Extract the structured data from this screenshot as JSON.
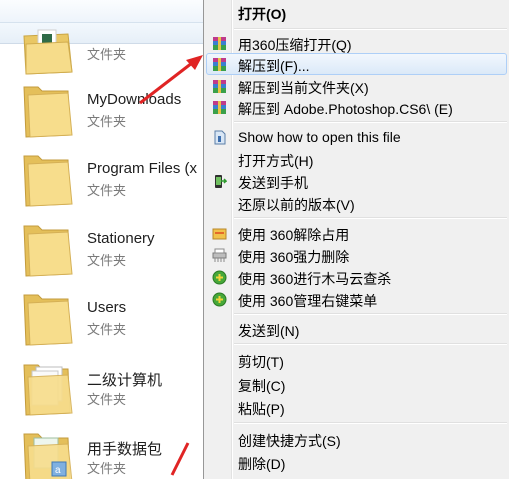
{
  "explorer": {
    "folders": [
      {
        "name": "",
        "type": "文件夹"
      },
      {
        "name": "MyDownloads",
        "type": "文件夹"
      },
      {
        "name": "Program Files (x",
        "type": "文件夹"
      },
      {
        "name": "Stationery",
        "type": "文件夹"
      },
      {
        "name": "Users",
        "type": "文件夹"
      },
      {
        "name": "二级计算机",
        "type": "文件夹"
      },
      {
        "name": "用手数据包",
        "type": "文件夹"
      }
    ]
  },
  "context_menu": {
    "items": [
      {
        "label": "打开(O)",
        "icon": "none",
        "bold": true
      },
      {
        "label": "用360压缩打开(Q)",
        "icon": "archive-icon"
      },
      {
        "label": "解压到(F)...",
        "icon": "archive-icon",
        "highlighted": true
      },
      {
        "label": "解压到当前文件夹(X)",
        "icon": "archive-icon"
      },
      {
        "label": "解压到 Adobe.Photoshop.CS6\\ (E)",
        "icon": "archive-icon"
      },
      {
        "label": "Show how to open this file",
        "icon": "file-info-icon"
      },
      {
        "label": "打开方式(H)",
        "icon": "none"
      },
      {
        "label": "发送到手机",
        "icon": "phone-send-icon"
      },
      {
        "label": "还原以前的版本(V)",
        "icon": "none"
      },
      {
        "label": "使用 360解除占用",
        "icon": "unlock-icon"
      },
      {
        "label": "使用 360强力删除",
        "icon": "shredder-icon"
      },
      {
        "label": "使用 360进行木马云查杀",
        "icon": "shield-360-icon"
      },
      {
        "label": "使用 360管理右键菜单",
        "icon": "shield-360-icon"
      },
      {
        "label": "发送到(N)",
        "icon": "none"
      },
      {
        "label": "剪切(T)",
        "icon": "none"
      },
      {
        "label": "复制(C)",
        "icon": "none"
      },
      {
        "label": "粘贴(P)",
        "icon": "none"
      },
      {
        "label": "创建快捷方式(S)",
        "icon": "none"
      },
      {
        "label": "删除(D)",
        "icon": "none"
      }
    ]
  },
  "colors": {
    "menu_bg": "#f0f0f0",
    "highlight_border": "#aecff7",
    "annotation_arrow": "#e02424",
    "folder_yellow": "#f3d478"
  }
}
